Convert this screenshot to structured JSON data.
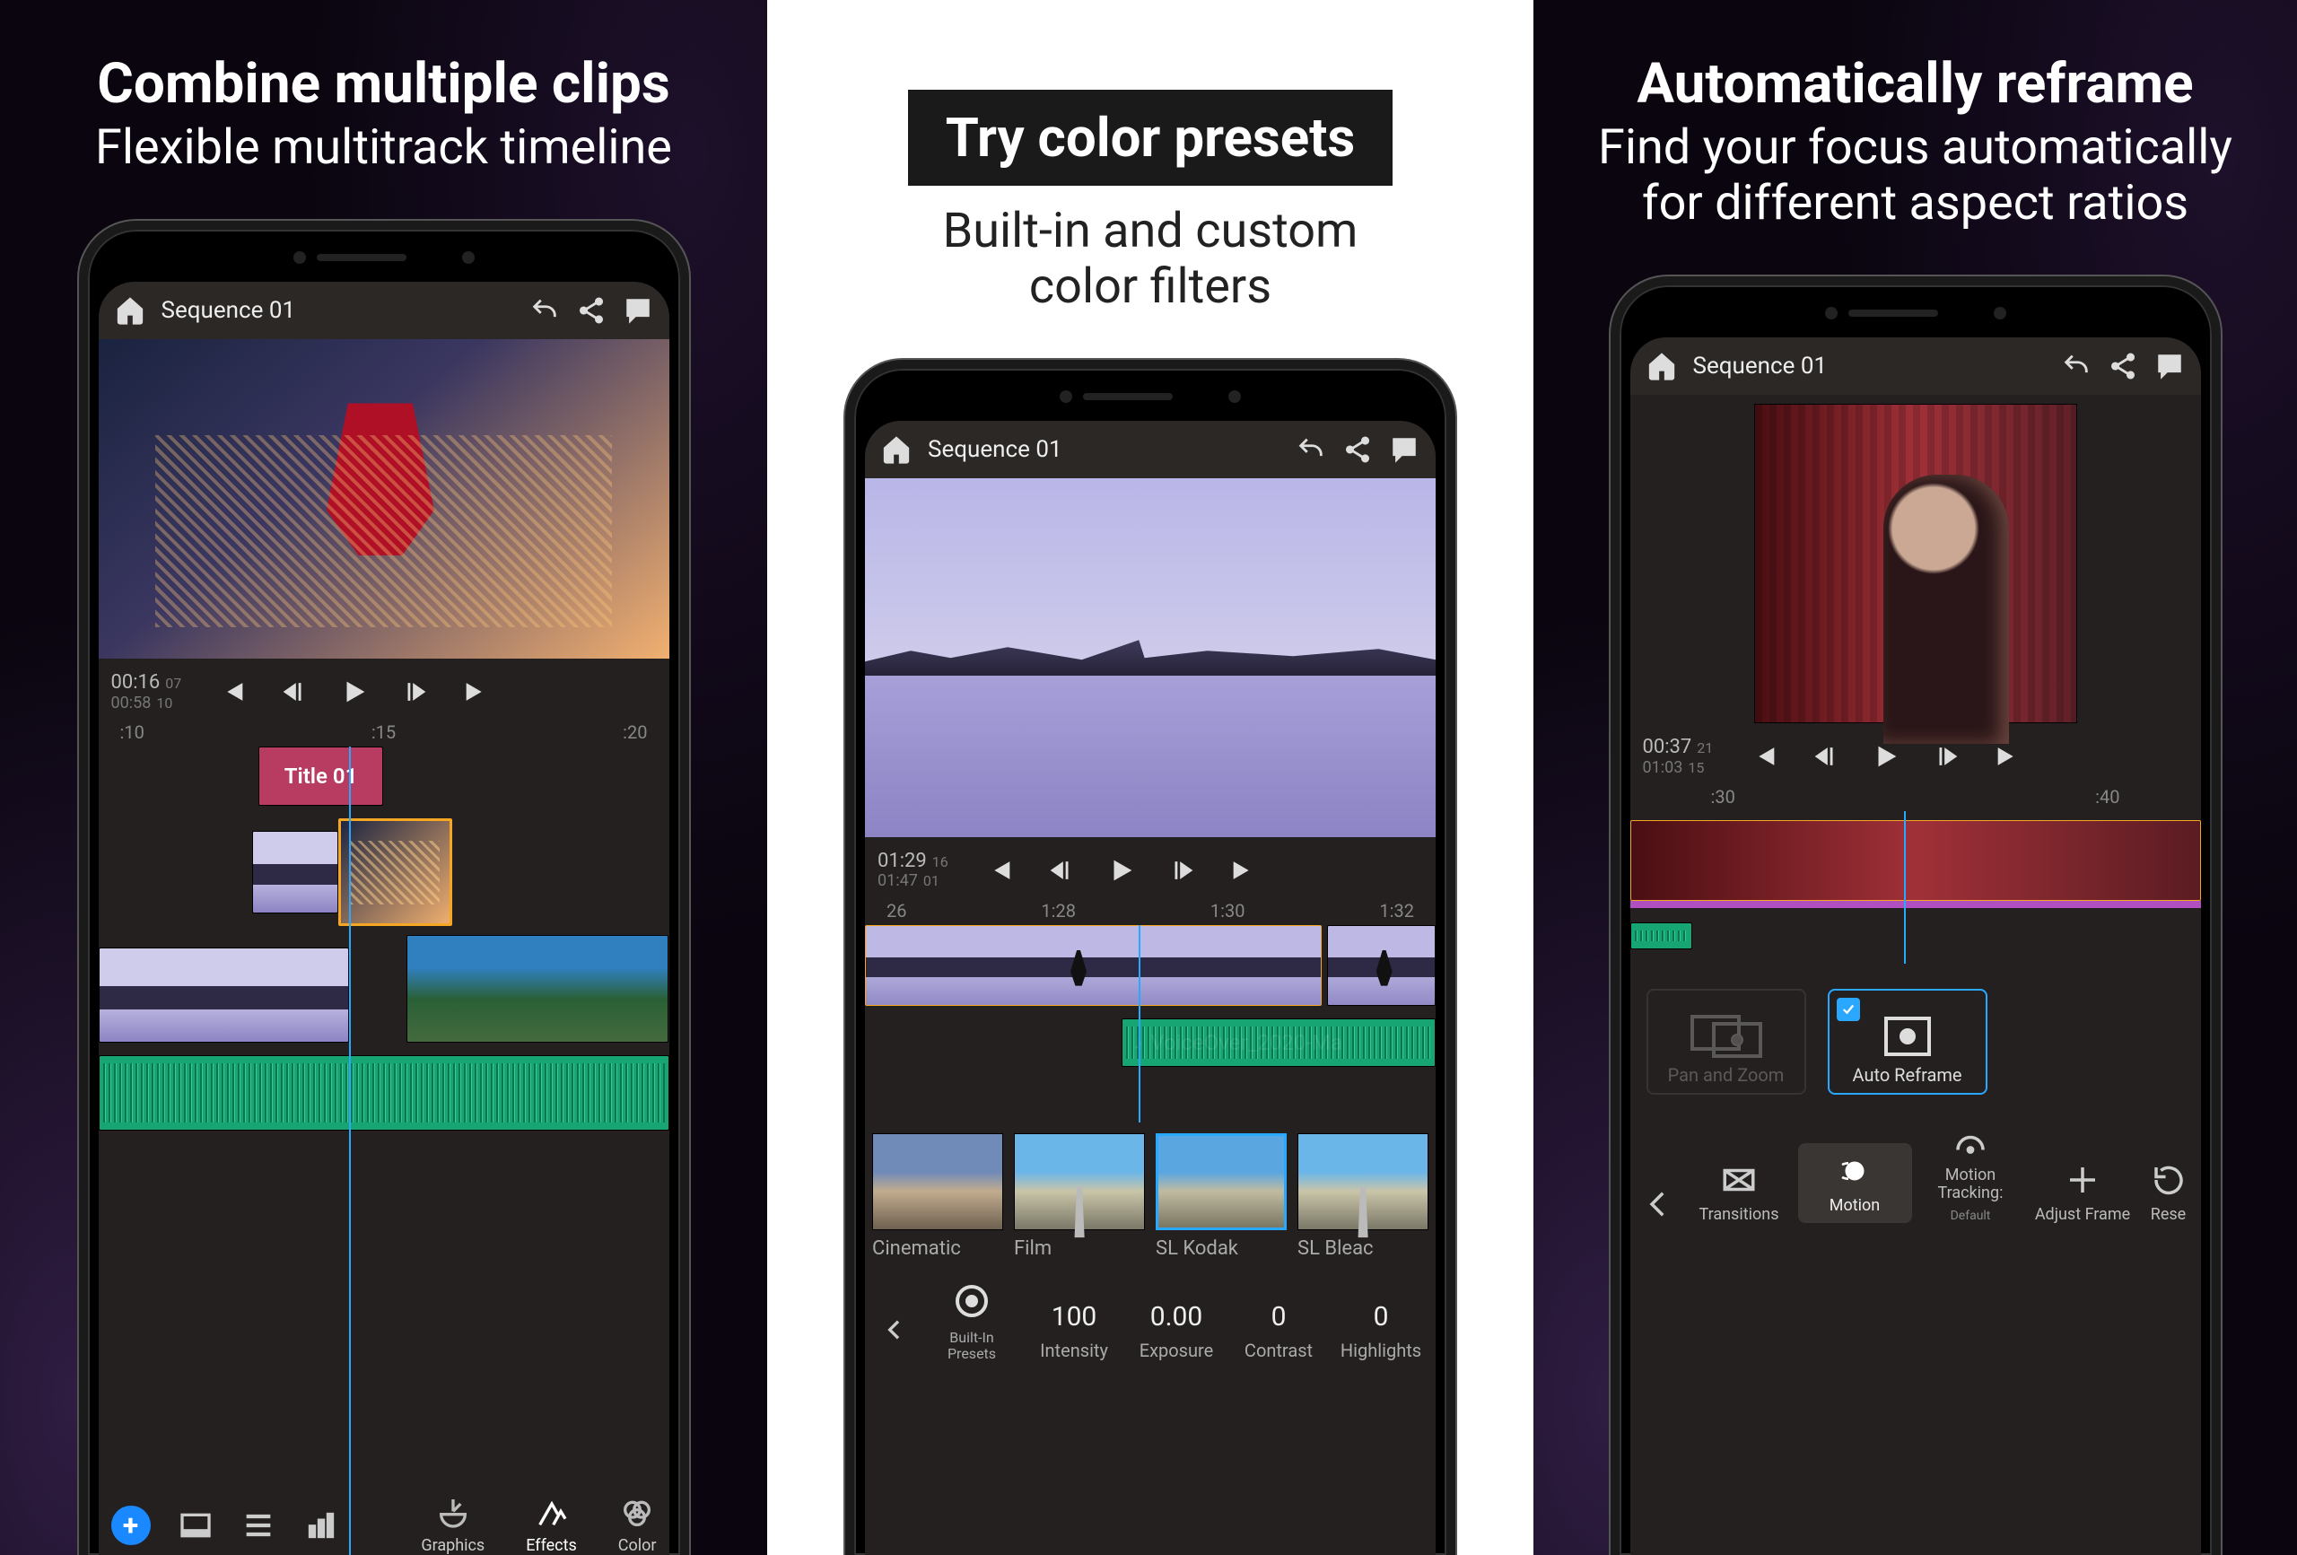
{
  "panel1": {
    "headline": "Combine multiple clips",
    "subhead": "Flexible multitrack timeline",
    "sequence_name": "Sequence 01",
    "timecode_cur": "00:16",
    "timecode_cur_frames": "07",
    "timecode_total": "00:58",
    "timecode_total_frames": "10",
    "ruler": [
      ":10",
      ":15",
      ":20"
    ],
    "title_clip_label": "Title 01",
    "toolbar_labels": {
      "graphics": "Graphics",
      "effects": "Effects",
      "color": "Color"
    }
  },
  "panel2": {
    "headline_box": "Try color presets",
    "subhead_l1": "Built-in and custom",
    "subhead_l2": "color filters",
    "sequence_name": "Sequence 01",
    "timecode_cur": "01:29",
    "timecode_cur_frames": "16",
    "timecode_total": "01:47",
    "timecode_total_frames": "01",
    "ruler": [
      "26",
      "1:28",
      "1:30",
      "1:32"
    ],
    "audio_clip_label": "VoiceOver_2020-Ma",
    "presets": [
      {
        "name": "Cinematic"
      },
      {
        "name": "Film"
      },
      {
        "name": "SL Kodak"
      },
      {
        "name": "SL Bleac"
      }
    ],
    "params": {
      "builtin": {
        "label": "Built-In Presets"
      },
      "intensity": {
        "value": "100",
        "label": "Intensity"
      },
      "exposure": {
        "value": "0.00",
        "label": "Exposure"
      },
      "contrast": {
        "value": "0",
        "label": "Contrast"
      },
      "highlights": {
        "value": "0",
        "label": "Highlights"
      }
    }
  },
  "panel3": {
    "headline": "Automatically reframe",
    "subhead_l1": "Find your focus automatically",
    "subhead_l2": "for different aspect ratios",
    "sequence_name": "Sequence 01",
    "timecode_cur": "00:37",
    "timecode_cur_frames": "21",
    "timecode_total": "01:03",
    "timecode_total_frames": "15",
    "ruler": [
      ":30",
      ":40"
    ],
    "motion_options": {
      "pan_zoom": "Pan and Zoom",
      "auto_reframe": "Auto Reframe"
    },
    "toolbar": {
      "transitions": "Transitions",
      "motion": "Motion",
      "motion_tracking": "Motion Tracking:",
      "motion_tracking_sub": "Default",
      "adjust_frame": "Adjust Frame",
      "reset": "Rese"
    }
  }
}
